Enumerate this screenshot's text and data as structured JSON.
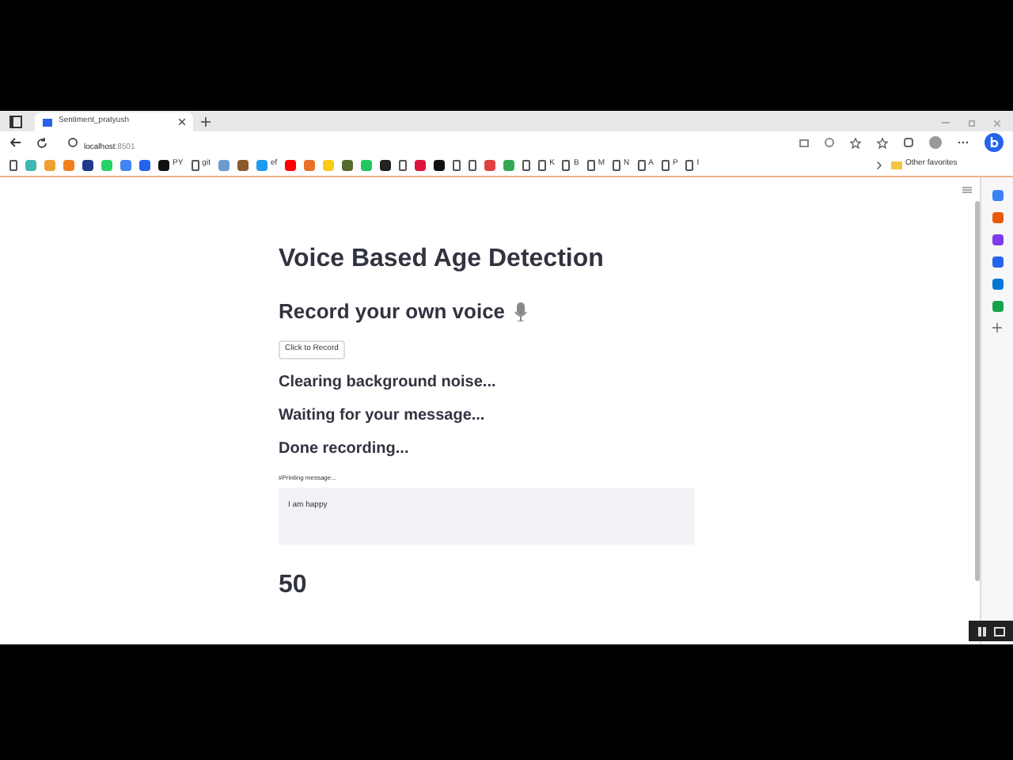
{
  "browser": {
    "tab": {
      "title": "Sentiment_pratyush",
      "selected": true
    },
    "address": {
      "host": "localhost",
      "port": ":8501"
    },
    "bookmarks": [
      {
        "kind": "doc"
      },
      {
        "kind": "dot",
        "color": "#3fb8b0"
      },
      {
        "kind": "dot",
        "color": "#f0a030"
      },
      {
        "kind": "dot",
        "color": "#f08020"
      },
      {
        "kind": "dot",
        "color": "#1e3a8a"
      },
      {
        "kind": "dot",
        "color": "#25d366"
      },
      {
        "kind": "dot",
        "color": "#4285f4"
      },
      {
        "kind": "dot",
        "color": "#2563eb"
      },
      {
        "kind": "dot",
        "color": "#111111",
        "label": "PY"
      },
      {
        "kind": "doc",
        "label": "git"
      },
      {
        "kind": "dot",
        "color": "#6b9bd1"
      },
      {
        "kind": "dot",
        "color": "#8b5a2b"
      },
      {
        "kind": "dot",
        "color": "#1d9bf0",
        "label": "ef"
      },
      {
        "kind": "dot",
        "color": "#ff0000"
      },
      {
        "kind": "dot",
        "color": "#e8712a"
      },
      {
        "kind": "dot",
        "color": "#facc15"
      },
      {
        "kind": "dot",
        "color": "#556b2f"
      },
      {
        "kind": "dot",
        "color": "#22c55e"
      },
      {
        "kind": "dot",
        "color": "#222222"
      },
      {
        "kind": "doc"
      },
      {
        "kind": "dot",
        "color": "#dc143c"
      },
      {
        "kind": "dot",
        "color": "#111111"
      },
      {
        "kind": "doc"
      },
      {
        "kind": "doc"
      },
      {
        "kind": "dot",
        "color": "#e04040"
      },
      {
        "kind": "dot",
        "color": "#34a853"
      },
      {
        "kind": "doc"
      },
      {
        "kind": "doc",
        "label": "K"
      },
      {
        "kind": "doc",
        "label": "B"
      },
      {
        "kind": "doc",
        "label": "M"
      },
      {
        "kind": "doc",
        "label": "N"
      },
      {
        "kind": "doc",
        "label": "A"
      },
      {
        "kind": "doc",
        "label": "P"
      },
      {
        "kind": "doc",
        "label": "I"
      }
    ],
    "other_favorites": "Other favorites"
  },
  "page": {
    "title": "Voice Based Age Detection",
    "subheader": "Record your own voice",
    "record_button": "Click to Record",
    "status_lines": [
      "Clearing background noise...",
      "Waiting for your message...",
      "Done recording..."
    ],
    "text_area": {
      "label": "#Printing message...",
      "value": "I am happy"
    },
    "result": "50"
  },
  "edge_sidebar": [
    {
      "color": "#3b82f6"
    },
    {
      "color": "#ea580c"
    },
    {
      "color": "#7c3aed"
    },
    {
      "color": "#2563eb"
    },
    {
      "color": "#0078d4"
    },
    {
      "color": "#16a34a"
    }
  ]
}
